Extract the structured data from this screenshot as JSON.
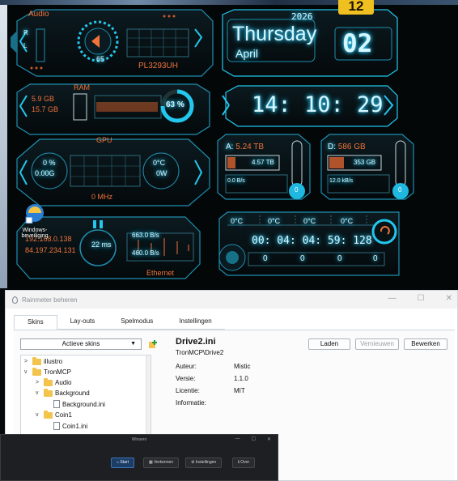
{
  "page_badge": "12",
  "audio": {
    "title": "Audio",
    "left": "R",
    "right": "L",
    "volume": "65",
    "device": "PL3293UH"
  },
  "date": {
    "year": "2026",
    "weekday": "Thursday",
    "month": "April",
    "day": "02"
  },
  "ram": {
    "title": "RAM",
    "total": "5.9 GB",
    "used": "15.7 GB",
    "percent": "63"
  },
  "time": {
    "value": "14: 10: 29"
  },
  "gpu": {
    "title": "GPU",
    "usage": "0 %",
    "mem": "0.00G",
    "temp": "0°C",
    "power": "0W",
    "clock": "0 MHz"
  },
  "drive_a": {
    "label": "A:",
    "capacity": "5.24 TB",
    "free": "4.57 TB",
    "rate": "0.0 B/s",
    "gauge": "0"
  },
  "drive_d": {
    "label": "D:",
    "capacity": "586 GB",
    "free": "353 GB",
    "rate": "12.0 kB/s",
    "gauge": "0"
  },
  "network": {
    "ip1": "192.168.0.138",
    "ip2": "84.197.234.131",
    "ping": "22 ms",
    "down": "663.0 B/s",
    "up": "460.0 B/s",
    "label": "Ethernet"
  },
  "temps": {
    "t1": "0°C",
    "t2": "0°C",
    "t3": "0°C",
    "t4": "0°C"
  },
  "uptime": {
    "value": "00: 04: 04: 59: 128",
    "c1": "0",
    "c2": "0",
    "c3": "0",
    "c4": "0"
  },
  "desktop_icon": {
    "label": "Windows-beveiliging"
  },
  "rainmeter": {
    "title": "Rainmeter beheren",
    "tabs": [
      "Skins",
      "Lay-outs",
      "Spelmodus",
      "Instellingen"
    ],
    "dropdown": "Actieve skins",
    "tree": [
      {
        "label": "illustro",
        "type": "folder",
        "state": ">"
      },
      {
        "label": "TronMCP",
        "type": "folder",
        "state": "v"
      },
      {
        "label": "Audio",
        "type": "folder",
        "state": ">"
      },
      {
        "label": "Background",
        "type": "folder",
        "state": "v"
      },
      {
        "label": "Background.ini",
        "type": "file",
        "state": ""
      },
      {
        "label": "Coin1",
        "type": "folder",
        "state": "v"
      },
      {
        "label": "Coin1.ini",
        "type": "file",
        "state": ""
      }
    ],
    "skin_name": "Drive2.ini",
    "skin_path": "TronMCP\\Drive2",
    "fields": [
      {
        "label": "Auteur:",
        "value": "Mistic"
      },
      {
        "label": "Versie:",
        "value": "1.1.0"
      },
      {
        "label": "Licentie:",
        "value": "MIT"
      },
      {
        "label": "Informatie:",
        "value": ""
      }
    ],
    "buttons": {
      "load": "Laden",
      "refresh": "Vernieuwen",
      "edit": "Bewerken"
    }
  },
  "winbox": {
    "title": "Winaero",
    "buttons": [
      "Start",
      "Verkennen",
      "Instellingen",
      "Over"
    ]
  },
  "colors": {
    "accent": "#23c7ee",
    "orange": "#f0733a",
    "gauge": "#1fb8e0"
  }
}
